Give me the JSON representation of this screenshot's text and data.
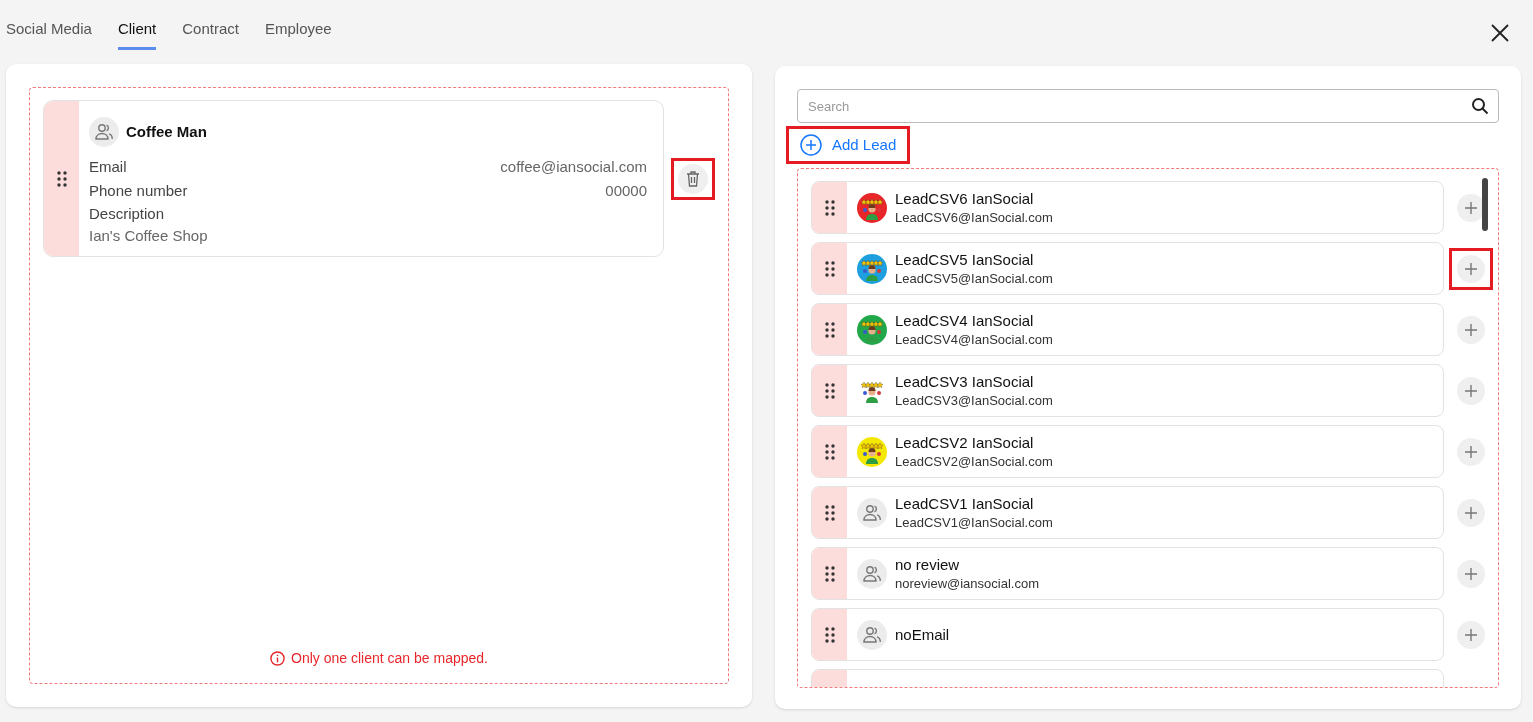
{
  "tabs": [
    {
      "label": "Social Media",
      "selected": false
    },
    {
      "label": "Client",
      "selected": true
    },
    {
      "label": "Contract",
      "selected": false
    },
    {
      "label": "Employee",
      "selected": false
    }
  ],
  "client": {
    "name": "Coffee Man",
    "fields": [
      {
        "label": "Email",
        "value": "coffee@iansocial.com"
      },
      {
        "label": "Phone number",
        "value": "00000"
      }
    ],
    "description_label": "Description",
    "description": "Ian's Coffee Shop",
    "highlighted": true
  },
  "notice": "Only one client can be mapped.",
  "search": {
    "placeholder": "Search"
  },
  "add_lead": {
    "label": "Add Lead",
    "highlighted": true
  },
  "leads": [
    {
      "name": "LeadCSV6 IanSocial",
      "email": "LeadCSV6@IanSocial.com",
      "kind": "picture",
      "color": "#e8262a",
      "highlighted": false
    },
    {
      "name": "LeadCSV5 IanSocial",
      "email": "LeadCSV5@IanSocial.com",
      "kind": "picture",
      "color": "#1ea0e0",
      "highlighted": true
    },
    {
      "name": "LeadCSV4 IanSocial",
      "email": "LeadCSV4@IanSocial.com",
      "kind": "picture",
      "color": "#22a84a",
      "highlighted": false
    },
    {
      "name": "LeadCSV3 IanSocial",
      "email": "LeadCSV3@IanSocial.com",
      "kind": "picture",
      "highlighted": false
    },
    {
      "name": "LeadCSV2 IanSocial",
      "email": "LeadCSV2@IanSocial.com",
      "kind": "picture",
      "color": "#f5e800",
      "highlighted": false
    },
    {
      "name": "LeadCSV1 IanSocial",
      "email": "LeadCSV1@IanSocial.com",
      "kind": "default",
      "highlighted": false
    },
    {
      "name": "no review",
      "email": "noreview@iansocial.com",
      "kind": "default",
      "highlighted": false
    },
    {
      "name": "noEmail",
      "kind": "default",
      "highlighted": false
    },
    {
      "kind": "partial"
    }
  ]
}
